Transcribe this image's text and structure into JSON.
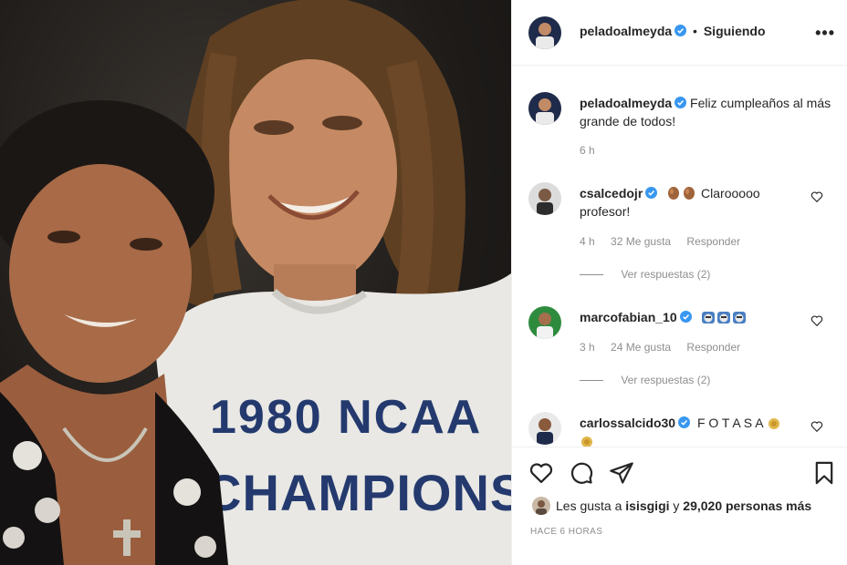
{
  "post": {
    "author": "peladoalmeyda",
    "follow_state": "Siguiendo",
    "separator": "•",
    "more_icon": "more-options-icon",
    "caption": "Feliz cumpleaños al más grande de todos!",
    "time": "6 h",
    "shirt_line1": "1980 NCAA",
    "shirt_line2": "CHAMPIONS"
  },
  "comments": [
    {
      "user": "csalcedojr",
      "text": "Clarooooo profesor!",
      "emoji": [
        "clap-emoji",
        "clap-emoji"
      ],
      "time": "4 h",
      "likes": "32 Me gusta",
      "reply": "Responder",
      "replies": "Ver respuestas (2)"
    },
    {
      "user": "marcofabian_10",
      "text": "",
      "emoji": [
        "face-emoji",
        "face-emoji",
        "face-emoji"
      ],
      "time": "3 h",
      "likes": "24 Me gusta",
      "reply": "Responder",
      "replies": "Ver respuestas (2)"
    },
    {
      "user": "carlossalcido30",
      "text": "F O T A S A",
      "emoji": [
        "medal-emoji",
        "medal-emoji"
      ]
    }
  ],
  "actions": {
    "like_icon": "heart-icon",
    "comment_icon": "comment-icon",
    "share_icon": "share-icon",
    "save_icon": "bookmark-icon"
  },
  "likes": {
    "prefix": "Les gusta a",
    "user": "isisgigi",
    "connector": "y",
    "count": "29,020 personas más"
  },
  "posted_ago": "HACE 6 HORAS",
  "colors": {
    "verified": "#3897f0",
    "shirt_text": "#243a6e",
    "muted": "#8e8e8e",
    "border": "#efefef"
  }
}
